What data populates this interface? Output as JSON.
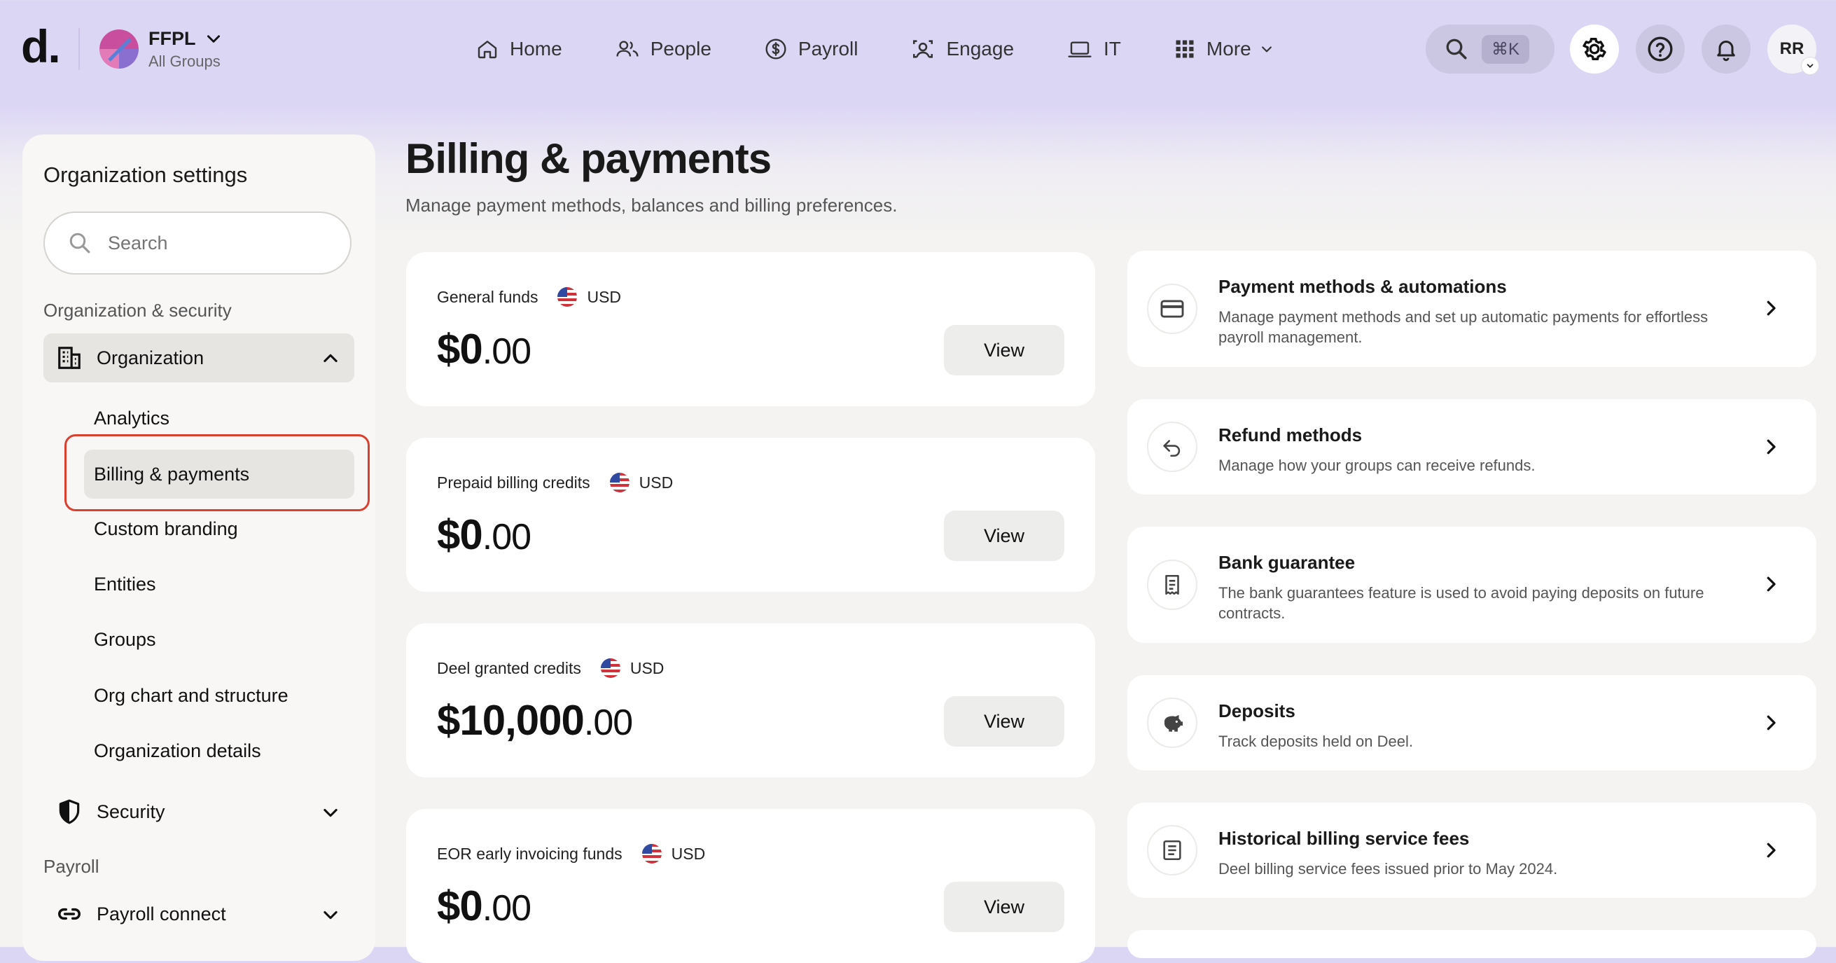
{
  "app": {
    "logo": "d."
  },
  "org": {
    "name": "FFPL",
    "sub": "All Groups"
  },
  "nav": [
    {
      "label": "Home",
      "icon": "home-icon"
    },
    {
      "label": "People",
      "icon": "people-icon"
    },
    {
      "label": "Payroll",
      "icon": "dollar-circle-icon"
    },
    {
      "label": "Engage",
      "icon": "engage-icon"
    },
    {
      "label": "IT",
      "icon": "laptop-icon"
    },
    {
      "label": "More",
      "icon": "grid-icon"
    }
  ],
  "header": {
    "search_shortcut": "⌘K",
    "user_initials": "RR"
  },
  "sidebar": {
    "title": "Organization settings",
    "search_placeholder": "Search",
    "section_org": "Organization & security",
    "group_org": "Organization",
    "sub_items": [
      "Analytics",
      "Billing & payments",
      "Custom branding",
      "Entities",
      "Groups",
      "Org chart and structure",
      "Organization details"
    ],
    "group_security": "Security",
    "section_payroll": "Payroll",
    "group_payroll_connect": "Payroll connect"
  },
  "page": {
    "title": "Billing & payments",
    "subtitle": "Manage payment methods, balances and billing preferences."
  },
  "funds": [
    {
      "label": "General funds",
      "currency": "USD",
      "whole": "$0",
      "cents": ".00",
      "button": "View"
    },
    {
      "label": "Prepaid billing credits",
      "currency": "USD",
      "whole": "$0",
      "cents": ".00",
      "button": "View"
    },
    {
      "label": "Deel granted credits",
      "currency": "USD",
      "whole": "$10,000",
      "cents": ".00",
      "button": "View"
    },
    {
      "label": "EOR early invoicing funds",
      "currency": "USD",
      "whole": "$0",
      "cents": ".00",
      "button": "View"
    }
  ],
  "settings": [
    {
      "title": "Payment methods & automations",
      "desc": "Manage payment methods and set up automatic payments for effortless payroll management.",
      "icon": "credit-card-icon"
    },
    {
      "title": "Refund methods",
      "desc": "Manage how your groups can receive refunds.",
      "icon": "undo-arrow-icon"
    },
    {
      "title": "Bank guarantee",
      "desc": "The bank guarantees feature is used to avoid paying deposits on future contracts.",
      "icon": "receipt-icon"
    },
    {
      "title": "Deposits",
      "desc": "Track deposits held on Deel.",
      "icon": "piggy-bank-icon"
    },
    {
      "title": "Historical billing service fees",
      "desc": "Deel billing service fees issued prior to May 2024.",
      "icon": "document-icon"
    }
  ]
}
